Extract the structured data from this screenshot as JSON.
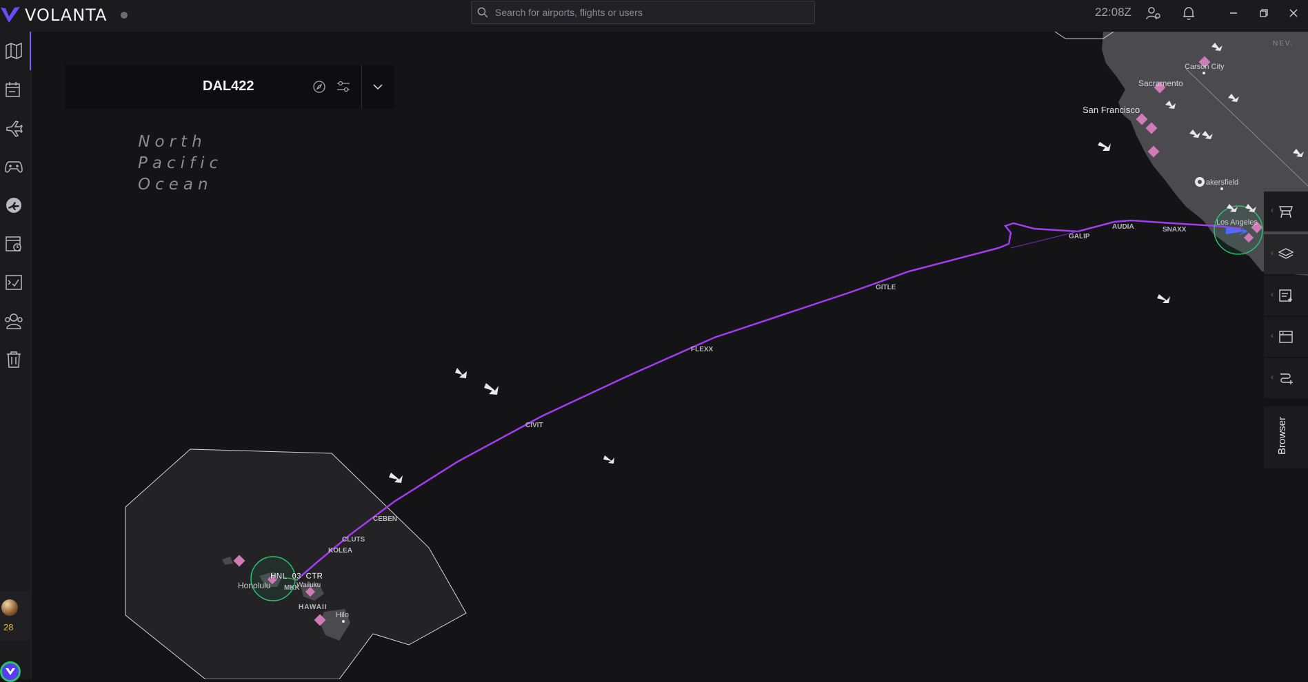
{
  "app": {
    "brand": "VOLANTA"
  },
  "search": {
    "placeholder": "Search for airports, flights or users"
  },
  "clock": "22:08Z",
  "sidebar": {
    "items": [
      {
        "name": "map-icon"
      },
      {
        "name": "flight-planner-icon"
      },
      {
        "name": "flights-icon"
      },
      {
        "name": "gamepad-icon"
      },
      {
        "name": "community-icon"
      },
      {
        "name": "schedule-icon"
      },
      {
        "name": "checklist-icon"
      },
      {
        "name": "users-icon"
      },
      {
        "name": "trash-icon"
      }
    ],
    "user": {
      "flights_count": "28"
    }
  },
  "flight_panel": {
    "callsign": "DAL422"
  },
  "map": {
    "ocean_label": [
      "North",
      "Pacific",
      "Ocean"
    ],
    "cities": [
      "Carson City",
      "Sacramento",
      "San Francisco",
      "akersfield",
      "Los Angeles",
      "Honolulu",
      "Wailuku",
      "Hilo",
      "NEV."
    ],
    "waypoints": [
      "GALIP",
      "AUDIA",
      "SNAXX",
      "GITLE",
      "FLEXX",
      "CIVIT",
      "CEBEN",
      "CLUTS",
      "KOLEA"
    ],
    "labels": {
      "sector": "HNL_03_CTR",
      "mkk": "MKK",
      "hawaii": "HAWAII"
    }
  },
  "right_rail": {
    "items": [
      {
        "name": "atc-tower-icon"
      },
      {
        "name": "layers-icon"
      },
      {
        "name": "notes-icon"
      },
      {
        "name": "window-icon"
      },
      {
        "name": "route-icon"
      }
    ],
    "browser_label": "Browser"
  },
  "colors": {
    "route": "#a23cf0",
    "airport": "#d07ab8",
    "accent": "#7b5cff",
    "atc_ring": "#27c46c"
  }
}
